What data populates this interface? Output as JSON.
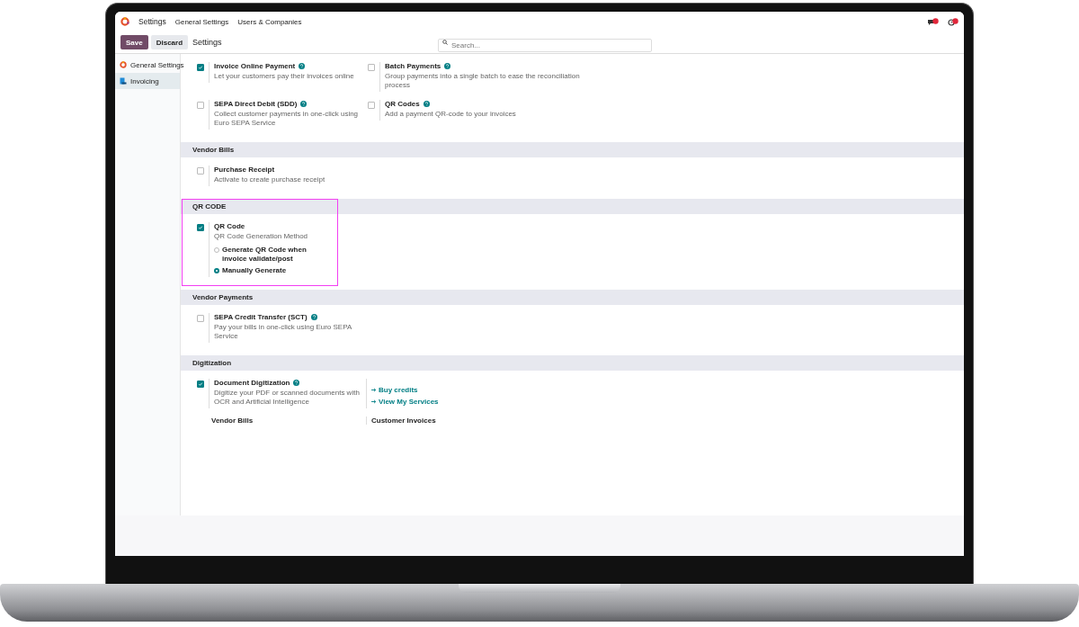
{
  "topbar": {
    "app": "Settings",
    "menu": [
      "General Settings",
      "Users & Companies"
    ]
  },
  "control_panel": {
    "buttons": [
      {
        "label": "Save",
        "kind": "primary"
      },
      {
        "label": "Discard",
        "kind": "secondary"
      }
    ],
    "breadcrumb": "Settings",
    "search": {
      "placeholder": "Search..."
    }
  },
  "sidebar": {
    "items": [
      {
        "label": "General Settings",
        "selected": false,
        "kind": "general"
      },
      {
        "label": "Invoicing",
        "selected": true,
        "kind": "invoicing"
      }
    ]
  },
  "sections": [
    {
      "highlighted": false,
      "settings": [
        {
          "kind": "toggle",
          "title": "Invoice Online Payment",
          "help": true,
          "checked": true,
          "description": "Let your customers pay their invoices online"
        },
        {
          "kind": "toggle",
          "title": "Batch Payments",
          "help": true,
          "checked": false,
          "description": "Group payments into a single batch to ease the reconciliation process"
        },
        {
          "kind": "toggle",
          "title": "SEPA Direct Debit (SDD)",
          "help": true,
          "checked": false,
          "description": "Collect customer payments in one-click using Euro SEPA Service"
        },
        {
          "kind": "toggle",
          "title": "QR Codes",
          "help": true,
          "checked": false,
          "description": "Add a payment QR-code to your invoices"
        }
      ]
    },
    {
      "title": "Vendor Bills",
      "highlighted": false,
      "settings": [
        {
          "kind": "toggle",
          "title": "Purchase Receipt",
          "help": false,
          "checked": false,
          "description": "Activate to create purchase receipt"
        }
      ]
    },
    {
      "title": "QR CODE",
      "highlighted": true,
      "settings": [
        {
          "kind": "toggle",
          "title": "QR Code",
          "help": false,
          "checked": true,
          "description": "QR Code Generation Method",
          "radios": [
            {
              "label": "Generate QR Code when invoice validate/post",
              "selected": false
            },
            {
              "label": "Manually Generate",
              "selected": true
            }
          ]
        }
      ]
    },
    {
      "title": "Vendor Payments",
      "highlighted": false,
      "settings": [
        {
          "kind": "toggle",
          "title": "SEPA Credit Transfer (SCT)",
          "help": true,
          "checked": false,
          "description": "Pay your bills in one-click using Euro SEPA Service"
        }
      ]
    },
    {
      "title": "Digitization",
      "highlighted": false,
      "settings": [
        {
          "kind": "toggle",
          "title": "Document Digitization",
          "help": true,
          "checked": true,
          "description": "Digitize your PDF or scanned documents with OCR and Artificial Intelligence"
        },
        {
          "kind": "links",
          "links": [
            "Buy credits",
            "View My Services"
          ]
        },
        {
          "kind": "label",
          "title": "Vendor Bills"
        },
        {
          "kind": "label",
          "title": "Customer Invoices"
        }
      ]
    }
  ]
}
